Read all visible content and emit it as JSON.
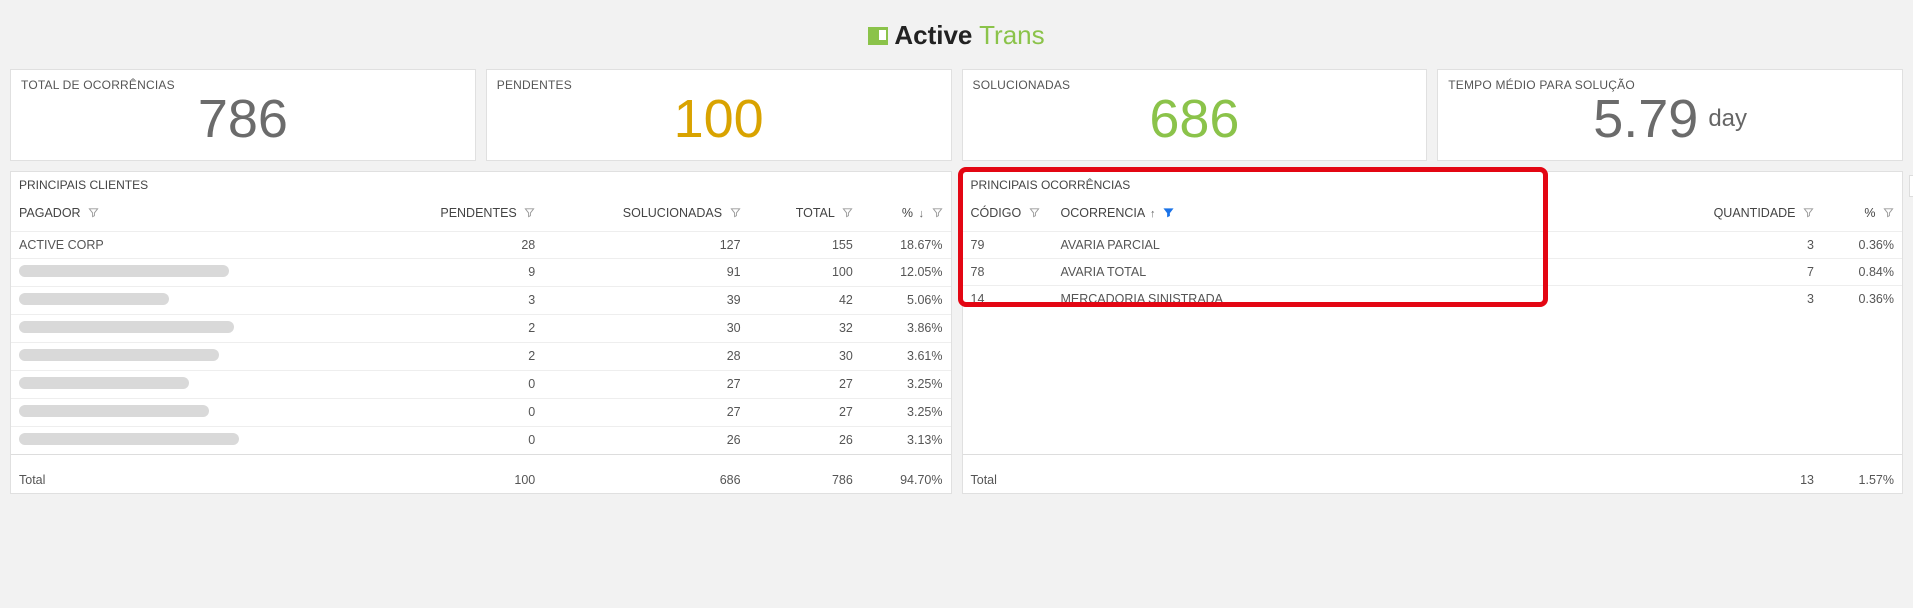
{
  "logo": {
    "bold": "Active",
    "light": " Trans"
  },
  "kpis": [
    {
      "label": "TOTAL DE OCORRÊNCIAS",
      "value": "786",
      "colorClass": "c-gray",
      "unit": ""
    },
    {
      "label": "PENDENTES",
      "value": "100",
      "colorClass": "c-amber",
      "unit": ""
    },
    {
      "label": "SOLUCIONADAS",
      "value": "686",
      "colorClass": "c-green",
      "unit": ""
    },
    {
      "label": "TEMPO MÉDIO PARA SOLUÇÃO",
      "value": "5.79",
      "colorClass": "c-gray",
      "unit": "day"
    }
  ],
  "clients": {
    "title": "PRINCIPAIS CLIENTES",
    "headers": {
      "pagador": "PAGADOR",
      "pendentes": "PENDENTES",
      "solucionadas": "SOLUCIONADAS",
      "total": "TOTAL",
      "percent": "%"
    },
    "rows": [
      {
        "pagador": "ACTIVE CORP",
        "redact": false,
        "redactW": 0,
        "pend": "28",
        "sol": "127",
        "tot": "155",
        "pct": "18.67%"
      },
      {
        "pagador": "",
        "redact": true,
        "redactW": 210,
        "pend": "9",
        "sol": "91",
        "tot": "100",
        "pct": "12.05%"
      },
      {
        "pagador": "",
        "redact": true,
        "redactW": 150,
        "pend": "3",
        "sol": "39",
        "tot": "42",
        "pct": "5.06%"
      },
      {
        "pagador": "",
        "redact": true,
        "redactW": 215,
        "pend": "2",
        "sol": "30",
        "tot": "32",
        "pct": "3.86%"
      },
      {
        "pagador": "",
        "redact": true,
        "redactW": 200,
        "pend": "2",
        "sol": "28",
        "tot": "30",
        "pct": "3.61%"
      },
      {
        "pagador": "",
        "redact": true,
        "redactW": 170,
        "pend": "0",
        "sol": "27",
        "tot": "27",
        "pct": "3.25%"
      },
      {
        "pagador": "",
        "redact": true,
        "redactW": 190,
        "pend": "0",
        "sol": "27",
        "tot": "27",
        "pct": "3.25%"
      },
      {
        "pagador": "",
        "redact": true,
        "redactW": 220,
        "pend": "0",
        "sol": "26",
        "tot": "26",
        "pct": "3.13%"
      }
    ],
    "totals": {
      "label": "Total",
      "pend": "100",
      "sol": "686",
      "tot": "786",
      "pct": "94.70%"
    }
  },
  "occurrences": {
    "title": "PRINCIPAIS OCORRÊNCIAS",
    "headers": {
      "codigo": "CÓDIGO",
      "ocorrencia": "OCORRENCIA",
      "quantidade": "QUANTIDADE",
      "percent": "%"
    },
    "rows": [
      {
        "codigo": "79",
        "ocorrencia": "AVARIA PARCIAL",
        "qtd": "3",
        "pct": "0.36%"
      },
      {
        "codigo": "78",
        "ocorrencia": "AVARIA TOTAL",
        "qtd": "7",
        "pct": "0.84%"
      },
      {
        "codigo": "14",
        "ocorrencia": "MERCADORIA SINISTRADA",
        "qtd": "3",
        "pct": "0.36%"
      }
    ],
    "totals": {
      "label": "Total",
      "qtd": "13",
      "pct": "1.57%"
    }
  }
}
